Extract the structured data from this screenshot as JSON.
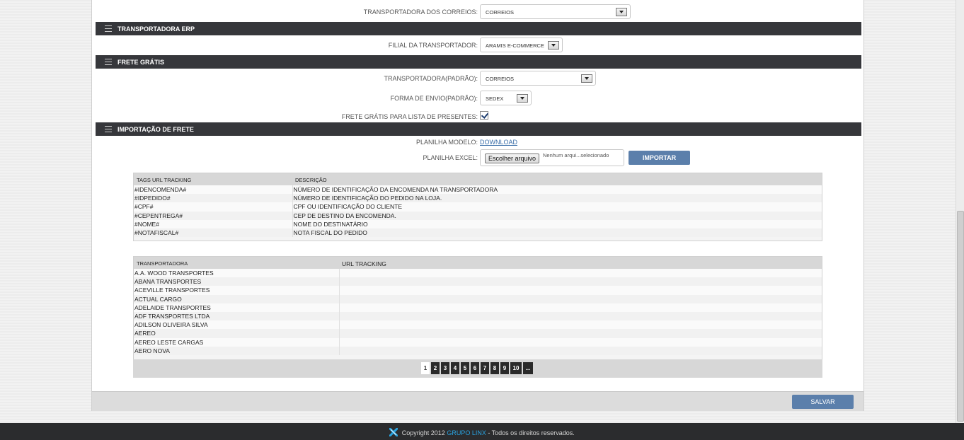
{
  "correios_row": {
    "label": "TRANSPORTADORA DOS CORREIOS:",
    "value": "CORREIOS"
  },
  "sections": {
    "erp": "TRANSPORTADORA ERP",
    "frete_gratis": "FRETE GRÁTIS",
    "importacao": "IMPORTAÇÃO DE FRETE"
  },
  "erp_row": {
    "label": "FILIAL DA TRANSPORTADOR:",
    "value": "ARAMIS E-COMMERCE"
  },
  "frete_gratis": {
    "transportadora_label": "TRANSPORTADORA(PADRÃO):",
    "transportadora_value": "CORREIOS",
    "forma_envio_label": "FORMA DE ENVIO(PADRÃO):",
    "forma_envio_value": "SEDEX",
    "lista_presentes_label": "FRETE GRÁTIS PARA LISTA DE PRESENTES:"
  },
  "importacao": {
    "modelo_label": "PLANILHA MODELO:",
    "download_link": "DOWNLOAD",
    "excel_label": "PLANILHA EXCEL:",
    "file_button": "Escolher arquivo",
    "file_status": "Nenhum arqui...selecionado",
    "import_button": "IMPORTAR"
  },
  "tags_table": {
    "headers": [
      "TAGS URL TRACKING",
      "DESCRIÇÃO"
    ],
    "rows": [
      [
        "#IDENCOMENDA#",
        "NÚMERO DE IDENTIFICAÇÃO DA ENCOMENDA NA TRANSPORTADORA"
      ],
      [
        "#IDPEDIDO#",
        "NÚMERO DE IDENTIFICAÇÃO DO PEDIDO NA LOJA."
      ],
      [
        "#CPF#",
        "CPF OU IDENTIFICAÇÃO DO CLIENTE"
      ],
      [
        "#CEPENTREGA#",
        "CEP DE DESTINO DA ENCOMENDA."
      ],
      [
        "#NOME#",
        "NOME DO DESTINATÁRIO"
      ],
      [
        "#NOTAFISCAL#",
        "NOTA FISCAL DO PEDIDO"
      ]
    ]
  },
  "carriers_table": {
    "headers": [
      "TRANSPORTADORA",
      "URL TRACKING"
    ],
    "rows": [
      "A.A. WOOD TRANSPORTES",
      "ABANA TRANSPORTES",
      "ACEVILLE TRANSPORTES",
      "ACTUAL CARGO",
      "ADELAIDE TRANSPORTES",
      "ADF TRANSPORTES LTDA",
      "ADILSON OLIVEIRA SILVA",
      "AEREO",
      "AEREO LESTE CARGAS",
      "AERO NOVA"
    ]
  },
  "pagination": {
    "pages": [
      "1",
      "2",
      "3",
      "4",
      "5",
      "6",
      "7",
      "8",
      "9",
      "10",
      "..."
    ],
    "active": "1"
  },
  "save_button": "SALVAR",
  "footer": {
    "copyright": "Copyright 2012 ",
    "brand": "GRUPO LINX",
    "rest": " - Todos os direitos reservados."
  },
  "colors": {
    "section_bar": "#36373b",
    "button_blue": "#5b7fab",
    "footer": "#2b2c2e",
    "brand": "#29a3e0"
  }
}
